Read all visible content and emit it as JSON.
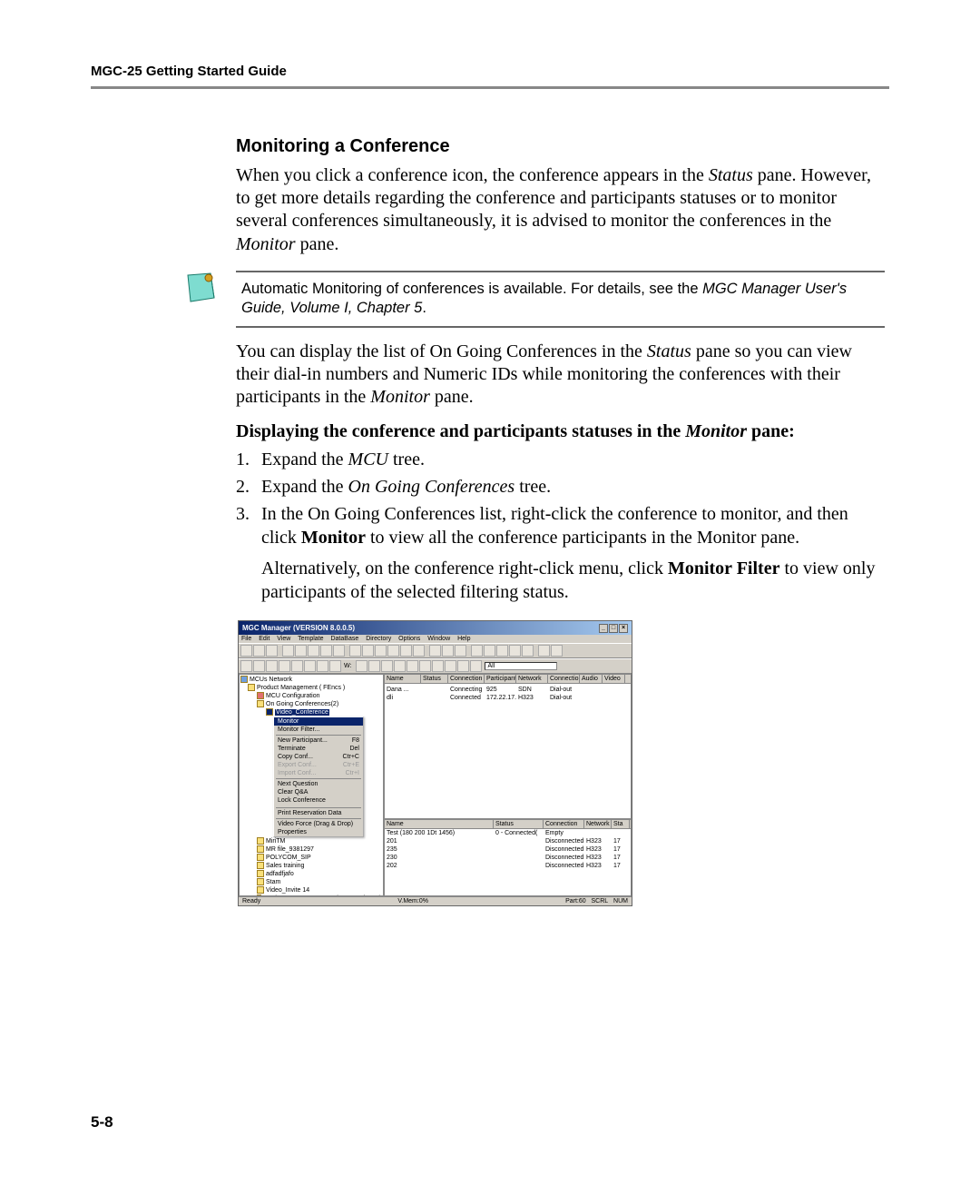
{
  "header": {
    "title": "MGC-25 Getting Started Guide"
  },
  "section": {
    "heading": "Monitoring a Conference",
    "p1a": "When you click a conference icon, the conference appears in the ",
    "p1b": "Status",
    "p1c": " pane. However, to get more details regarding the conference and participants statuses or to monitor several conferences simultaneously, it is advised to monitor the conferences in the ",
    "p1d": "Monitor",
    "p1e": " pane.",
    "note_a": "Automatic Monitoring of conferences is available. For details, see the ",
    "note_b": "MGC Manager User's Guide, Volume I, Chapter 5",
    "note_c": ".",
    "p2a": "You can display the list of On Going Conferences in the ",
    "p2b": "Status",
    "p2c": " pane so you can view their dial-in numbers and Numeric IDs while monitoring the conferences with their participants in the ",
    "p2d": "Monitor",
    "p2e": " pane.",
    "bold_a": "Displaying the conference and participants statuses in the ",
    "bold_b": "Monitor",
    "bold_c": " pane:",
    "steps": [
      {
        "num": "1.",
        "pre": "Expand the ",
        "it": "MCU",
        "post": " tree."
      },
      {
        "num": "2.",
        "pre": "Expand the ",
        "it": "On Going Conferences",
        "post": " tree."
      },
      {
        "num": "3.",
        "pre": "In the On Going Conferences list, right-click the conference to monitor, and then click ",
        "bold": "Monitor",
        "post": " to view all the conference participants in the Monitor pane."
      }
    ],
    "alt_a": "Alternatively, on the conference right-click menu, click ",
    "alt_b": "Monitor Filter",
    "alt_c": " to view only participants of the selected filtering status."
  },
  "shot": {
    "title": "MGC Manager (VERSION 8.0.0.5)",
    "menus": [
      "File",
      "Edit",
      "View",
      "Template",
      "DataBase",
      "Directory",
      "Options",
      "Window",
      "Help"
    ],
    "comboAll": "All",
    "tree": {
      "root": "MCUs Network",
      "n1": "Product Management ( FEncs )",
      "n2": "MCU Configuration",
      "n3": "On Going Conferences(2)",
      "n4": "Video_Conference",
      "n5": "",
      "bottom": [
        "MiriTM",
        "MR file_9381297",
        "POLYCOM_SIP",
        "Sales training",
        "adfadfjafo",
        "Stam",
        "Video_Invite 14",
        "Product Management-FE ( Connecting... )"
      ]
    },
    "ctx": [
      {
        "t": "Monitor",
        "hl": true
      },
      {
        "t": "Monitor Filter..."
      },
      {
        "hr": true
      },
      {
        "t": "New Participant...",
        "k": "F8"
      },
      {
        "t": "Terminate",
        "k": "Del"
      },
      {
        "t": "Copy Conf...",
        "k": "Ctr+C"
      },
      {
        "t": "Export Conf...",
        "dis": true,
        "k": "Ctr+E"
      },
      {
        "t": "Import Conf...",
        "dis": true,
        "k": "Ctr+I"
      },
      {
        "hr": true
      },
      {
        "t": "Next Question"
      },
      {
        "t": "Clear Q&A"
      },
      {
        "t": "Lock Conference"
      },
      {
        "t": "",
        "dis": true
      },
      {
        "hr": true
      },
      {
        "t": "Print Reservation Data"
      },
      {
        "hr": true
      },
      {
        "t": "Video Force (Drag & Drop)"
      },
      {
        "t": "Properties"
      }
    ],
    "topcols": [
      "Name",
      "Status",
      "Connection",
      "Participant",
      "Network",
      "Connectio...",
      "Audio",
      "Video"
    ],
    "toprows": [
      {
        "name": "",
        "status": "",
        "conn": "",
        "p": "",
        "net": "",
        "c": "",
        "a": "",
        "v": ""
      },
      {
        "name": "Dana ...",
        "status": "",
        "conn": "Connecting",
        "p": "925",
        "net": "SDN",
        "c": "Dial-out",
        "a": "",
        "v": ""
      },
      {
        "name": "dli",
        "status": "",
        "conn": "Connected",
        "p": "172.22.17...",
        "net": "H323",
        "c": "Dial-out",
        "a": "",
        "v": ""
      }
    ],
    "botcols": [
      "Name",
      "Status",
      "Connection",
      "Network",
      "Sta"
    ],
    "botrows": [
      {
        "name": "Test (180 200 1Dt 1456)",
        "status": "0 - Connected(",
        "conn": "Empty",
        "net": "",
        "sta": ""
      },
      {
        "name": "201",
        "status": "",
        "conn": "Disconnected",
        "net": "H323",
        "sta": "17"
      },
      {
        "name": "235",
        "status": "",
        "conn": "Disconnected",
        "net": "H323",
        "sta": "17"
      },
      {
        "name": "230",
        "status": "",
        "conn": "Disconnected",
        "net": "H323",
        "sta": "17"
      },
      {
        "name": "202",
        "status": "",
        "conn": "Disconnected",
        "net": "H323",
        "sta": "17"
      }
    ],
    "status": {
      "left": "Ready",
      "mid": "V.Mem:0%",
      "r1": "Part:60",
      "r2": "SCRL",
      "r3": "NUM"
    }
  },
  "page": "5-8"
}
